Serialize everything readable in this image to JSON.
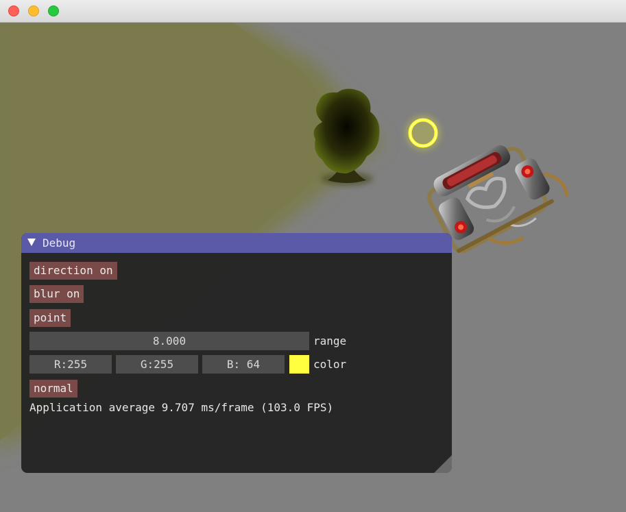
{
  "window": {
    "buttons": [
      "close",
      "minimize",
      "zoom"
    ]
  },
  "scene": {
    "light_color": "#ffff40",
    "background_color": "#808080",
    "objects": [
      "tree",
      "light-ring",
      "mech-sprite"
    ]
  },
  "debug": {
    "title": "Debug",
    "collapse_icon": "triangle-down-icon",
    "direction_button": "direction on",
    "blur_button": "blur on",
    "point_button": "point",
    "range_value": "8.000",
    "range_label": "range",
    "color": {
      "r": "R:255",
      "g": "G:255",
      "b": "B: 64",
      "label": "color",
      "swatch": "#ffff40"
    },
    "normal_button": "normal",
    "stats": "Application average 9.707 ms/frame (103.0 FPS)"
  }
}
